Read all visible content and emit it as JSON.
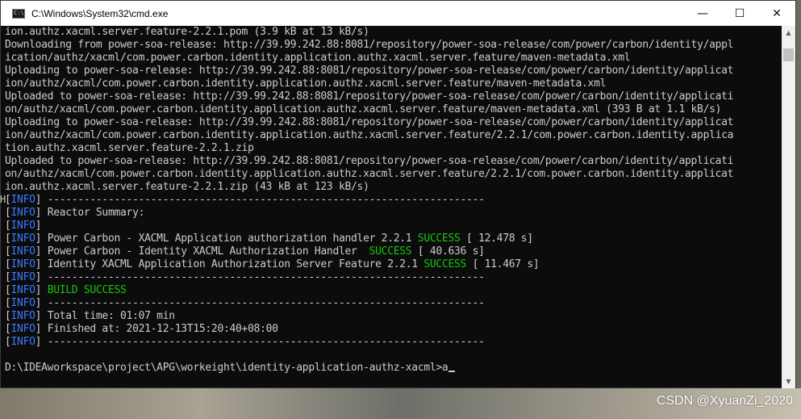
{
  "window": {
    "title": "C:\\Windows\\System32\\cmd.exe",
    "icon": "cmd-app-icon",
    "icon_text": "C:\\",
    "controls": {
      "minimize": "—",
      "maximize": "☐",
      "close": "✕"
    }
  },
  "console": {
    "lines": [
      [
        {
          "t": "ion.authz.xacml.server.feature-2.2.1.pom (3.9 kB at 13 kB/s)"
        }
      ],
      [
        {
          "t": "Downloading from power-soa-release: http://39.99.242.88:8081/repository/power-soa-release/com/power/carbon/identity/appl"
        }
      ],
      [
        {
          "t": "ication/authz/xacml/com.power.carbon.identity.application.authz.xacml.server.feature/maven-metadata.xml"
        }
      ],
      [
        {
          "t": "Uploading to power-soa-release: http://39.99.242.88:8081/repository/power-soa-release/com/power/carbon/identity/applicat"
        }
      ],
      [
        {
          "t": "ion/authz/xacml/com.power.carbon.identity.application.authz.xacml.server.feature/maven-metadata.xml"
        }
      ],
      [
        {
          "t": "Uploaded to power-soa-release: http://39.99.242.88:8081/repository/power-soa-release/com/power/carbon/identity/applicati"
        }
      ],
      [
        {
          "t": "on/authz/xacml/com.power.carbon.identity.application.authz.xacml.server.feature/maven-metadata.xml (393 B at 1.1 kB/s)"
        }
      ],
      [
        {
          "t": "Uploading to power-soa-release: http://39.99.242.88:8081/repository/power-soa-release/com/power/carbon/identity/applicat"
        }
      ],
      [
        {
          "t": "ion/authz/xacml/com.power.carbon.identity.application.authz.xacml.server.feature/2.2.1/com.power.carbon.identity.applica"
        }
      ],
      [
        {
          "t": "tion.authz.xacml.server.feature-2.2.1.zip"
        }
      ],
      [
        {
          "t": "Uploaded to power-soa-release: http://39.99.242.88:8081/repository/power-soa-release/com/power/carbon/identity/applicati"
        }
      ],
      [
        {
          "t": "on/authz/xacml/com.power.carbon.identity.application.authz.xacml.server.feature/2.2.1/com.power.carbon.identity.applicat"
        }
      ],
      [
        {
          "t": "ion.authz.xacml.server.feature-2.2.1.zip (43 kB at 123 kB/s)"
        }
      ],
      [
        {
          "t": "["
        },
        {
          "t": "INFO",
          "c": "blue"
        },
        {
          "t": "] ------------------------------------------------------------------------"
        }
      ],
      [
        {
          "t": "["
        },
        {
          "t": "INFO",
          "c": "blue"
        },
        {
          "t": "] Reactor Summary:"
        }
      ],
      [
        {
          "t": "["
        },
        {
          "t": "INFO",
          "c": "blue"
        },
        {
          "t": "]"
        }
      ],
      [
        {
          "t": "["
        },
        {
          "t": "INFO",
          "c": "blue"
        },
        {
          "t": "] Power Carbon - XACML Application authorization handler 2.2.1 "
        },
        {
          "t": "SUCCESS",
          "c": "green"
        },
        {
          "t": " [ 12.478 s]"
        }
      ],
      [
        {
          "t": "["
        },
        {
          "t": "INFO",
          "c": "blue"
        },
        {
          "t": "] Power Carbon - Identity XACML Authorization Handler  "
        },
        {
          "t": "SUCCESS",
          "c": "green"
        },
        {
          "t": " [ 40.636 s]"
        }
      ],
      [
        {
          "t": "["
        },
        {
          "t": "INFO",
          "c": "blue"
        },
        {
          "t": "] Identity XACML Application Authorization Server Feature 2.2.1 "
        },
        {
          "t": "SUCCESS",
          "c": "green"
        },
        {
          "t": " [ 11.467 s]"
        }
      ],
      [
        {
          "t": "["
        },
        {
          "t": "INFO",
          "c": "blue"
        },
        {
          "t": "] ------------------------------------------------------------------------"
        }
      ],
      [
        {
          "t": "["
        },
        {
          "t": "INFO",
          "c": "blue"
        },
        {
          "t": "] "
        },
        {
          "t": "BUILD SUCCESS",
          "c": "green"
        }
      ],
      [
        {
          "t": "["
        },
        {
          "t": "INFO",
          "c": "blue"
        },
        {
          "t": "] ------------------------------------------------------------------------"
        }
      ],
      [
        {
          "t": "["
        },
        {
          "t": "INFO",
          "c": "blue"
        },
        {
          "t": "] Total time: 01:07 min"
        }
      ],
      [
        {
          "t": "["
        },
        {
          "t": "INFO",
          "c": "blue"
        },
        {
          "t": "] Finished at: 2021-12-13T15:20:40+08:00"
        }
      ],
      [
        {
          "t": "["
        },
        {
          "t": "INFO",
          "c": "blue"
        },
        {
          "t": "] ------------------------------------------------------------------------"
        }
      ],
      [
        {
          "t": ""
        }
      ],
      [
        {
          "t": "D:\\IDEAworkspace\\project\\APG\\workeight\\identity-application-authz-xacml>a"
        }
      ]
    ]
  },
  "colors": {
    "console_bg": "#0c0c0c",
    "console_text": "#cccccc",
    "info_blue": "#3b78ff",
    "success_green": "#16c60c"
  },
  "watermark": "CSDN @XyuanZi_2020",
  "left_peek": "H"
}
